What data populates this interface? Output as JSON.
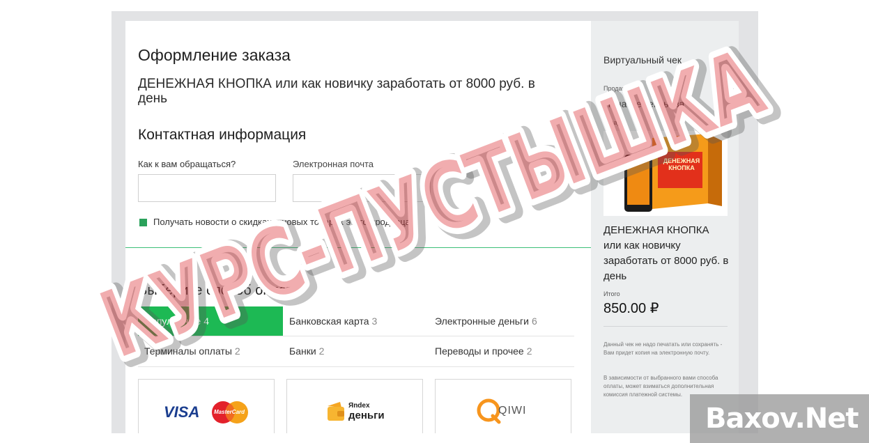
{
  "checkout": {
    "title": "Оформление заказа",
    "product_title": "ДЕНЕЖНАЯ КНОПКА или как новичку заработать от 8000 руб. в день",
    "contact_heading": "Контактная информация",
    "name_label": "Как к вам обращаться?",
    "name_value": "",
    "email_label": "Электронная почта",
    "email_value": "",
    "news_checkbox_label": "Получать новости о скидках и новых товарах этого продавца",
    "payment_heading": "Выберите способ оплаты"
  },
  "tabs": [
    {
      "label": "Популярные",
      "count": "4",
      "active": true
    },
    {
      "label": "Банковская карта",
      "count": "3",
      "active": false
    },
    {
      "label": "Электронные деньги",
      "count": "6",
      "active": false
    },
    {
      "label": "Терминалы оплаты",
      "count": "2",
      "active": false
    },
    {
      "label": "Банки",
      "count": "2",
      "active": false
    },
    {
      "label": "Переводы и прочее",
      "count": "2",
      "active": false
    }
  ],
  "payment_methods": [
    {
      "visa": "VISA",
      "mastercard": "MasterCard"
    },
    {
      "brand_small": "Яndex",
      "brand": "деньги"
    },
    {
      "brand": "QIWI"
    }
  ],
  "receipt": {
    "title": "Виртуальный чек",
    "seller_label": "Продавец",
    "seller_name": "Нина Дементьева",
    "product_label": "Товар",
    "cover_text": "ДЕНЕЖНАЯ КНОПКА",
    "product_name": "ДЕНЕЖНАЯ КНОПКА или как новичку заработать от 8000 руб. в день",
    "total_label": "Итого",
    "total_value": "850.00 ₽",
    "note_1": "Данный чек не надо печатать или сохранять - Вам придет копия на электронную почту.",
    "note_2": "В зависимости от выбранного вами способа оплаты, может взиматься дополнительная комиссия платежной системы."
  },
  "overlay": {
    "stamp_text": "КУРС-ПУСТЫШКА",
    "watermark": "Baxov.Net"
  },
  "colors": {
    "accent": "#1db954",
    "stamp": "#d9272e",
    "panel": "#eceeef"
  }
}
